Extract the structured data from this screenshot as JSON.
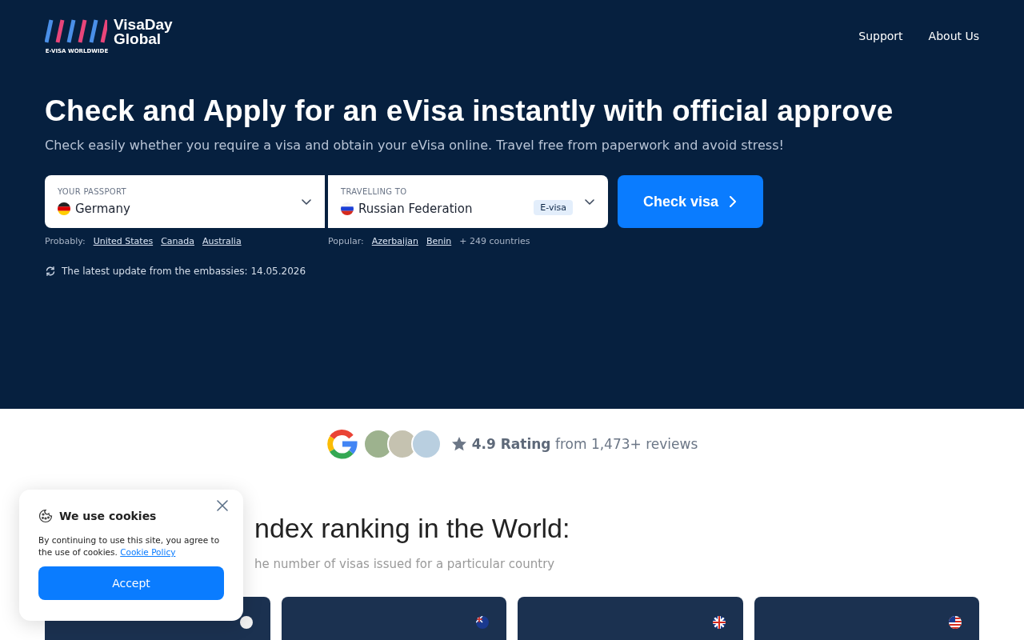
{
  "header": {
    "logo": {
      "name": "VisaDay\nGlobal",
      "tagline": "E-VISA WORLDWIDE"
    },
    "nav": [
      "Support",
      "About Us"
    ]
  },
  "hero": {
    "title": "Check and Apply for an eVisa instantly with official approve",
    "subtitle": "Check easily whether you require a visa and obtain your eVisa online. Travel free from paperwork and avoid stress!",
    "passport": {
      "label": "YOUR PASSPORT",
      "value": "Germany"
    },
    "destination": {
      "label": "TRAVELLING TO",
      "value": "Russian Federation",
      "badge": "E-visa"
    },
    "button": "Check visa",
    "probably": {
      "label": "Probably:",
      "links": [
        "United States",
        "Canada",
        "Australia"
      ]
    },
    "popular": {
      "label": "Popular:",
      "links": [
        "Azerbaijan",
        "Benin"
      ],
      "more": "+ 249 countries"
    },
    "update": "The latest update from the embassies: 14.05.2026"
  },
  "rating": {
    "score": "4.9 Rating",
    "text": "from 1,473+ reviews"
  },
  "ranking": {
    "title": "ndex ranking in the World:",
    "subtitle": "he number of visas issued for a particular country"
  },
  "cookie": {
    "title": "We use cookies",
    "text": "By continuing to use this site, you agree to the use of cookies.",
    "link": "Cookie Policy",
    "button": "Accept"
  }
}
